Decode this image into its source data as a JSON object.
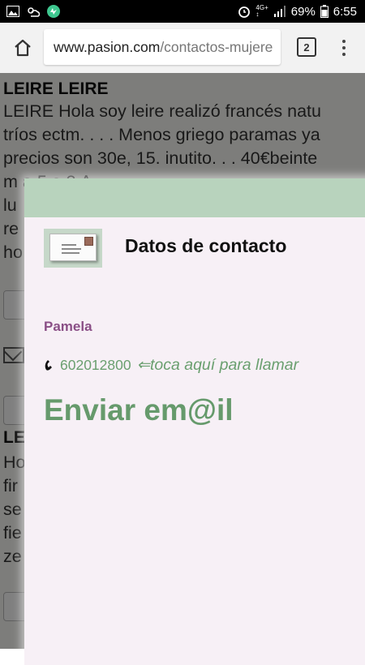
{
  "status_bar": {
    "network_top": "4G+",
    "network_bottom": "↕",
    "battery": "69%",
    "time": "6:55"
  },
  "browser": {
    "url_domain": "www.pasion.com",
    "url_path": "/contactos-mujere",
    "tab_count": "2"
  },
  "background_page": {
    "listing1_title": "LEIRE LEIRE",
    "listing1_lines": [
      "LEIRE Hola soy leire realizó francés natu",
      "tríos ectm. . . . Menos griego paramas ya",
      "precios son 30e, 15. inutito. . . 40€beinte",
      "m          a         5        a           3     ∆   ₄",
      "lu",
      "re",
      "ho"
    ],
    "listing2_title": "LE",
    "listing2_lines": [
      "Ho",
      "fir",
      "se",
      "fie",
      "ze"
    ]
  },
  "modal": {
    "title": "Datos de contacto",
    "contact_name": "Pamela",
    "phone_number": "602012800",
    "call_hint": "⇐toca aquí para llamar",
    "email_link": "Enviar em@il"
  }
}
